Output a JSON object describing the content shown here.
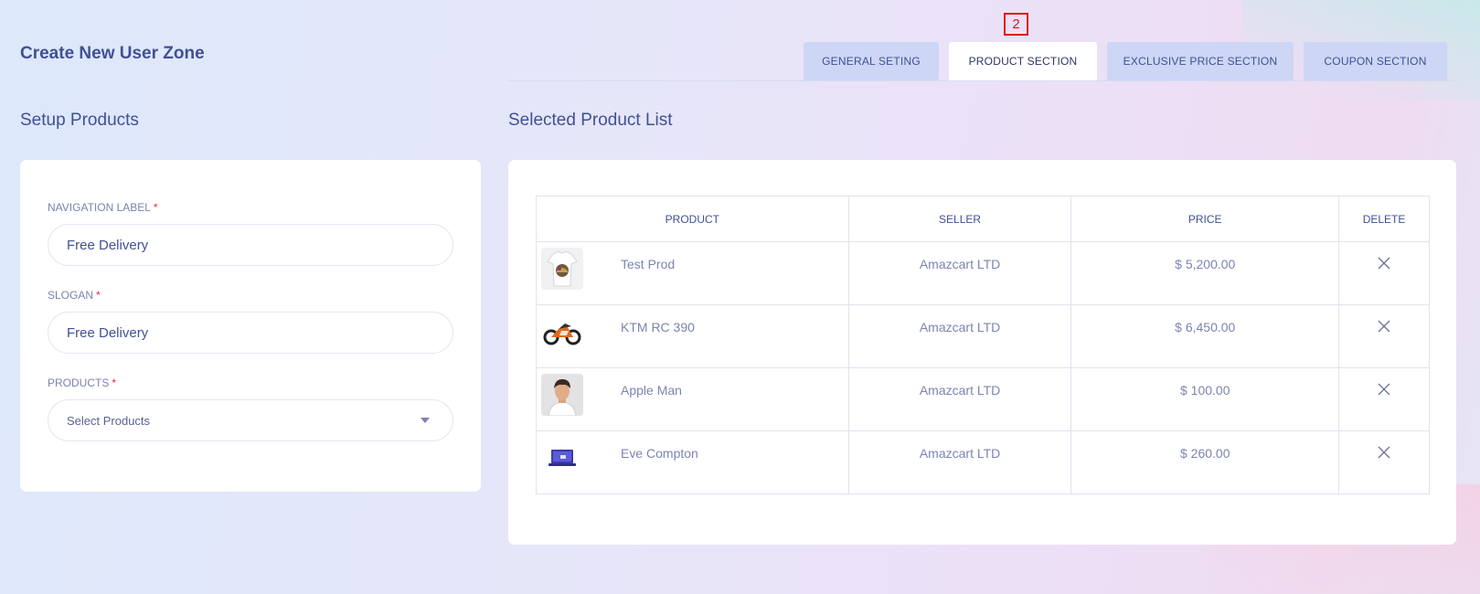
{
  "page": {
    "title": "Create New User Zone"
  },
  "tabs": {
    "marker": "2",
    "items": [
      {
        "label": "GENERAL SETING"
      },
      {
        "label": "PRODUCT SECTION",
        "active": true
      },
      {
        "label": "EXCLUSIVE PRICE SECTION"
      },
      {
        "label": "COUPON SECTION"
      }
    ]
  },
  "setup": {
    "title": "Setup Products",
    "navigation_label": {
      "label": "NAVIGATION LABEL",
      "required": "*",
      "value": "Free Delivery"
    },
    "slogan": {
      "label": "SLOGAN",
      "required": "*",
      "value": "Free Delivery"
    },
    "products": {
      "label": "PRODUCTS",
      "required": "*",
      "placeholder": "Select Products"
    }
  },
  "selected": {
    "title": "Selected Product List",
    "columns": {
      "product": "PRODUCT",
      "seller": "SELLER",
      "price": "PRICE",
      "delete": "DELETE"
    },
    "rows": [
      {
        "product": "Test Prod",
        "seller": "Amazcart LTD",
        "price": "$ 5,200.00",
        "thumb": "tshirt-image"
      },
      {
        "product": "KTM RC 390",
        "seller": "Amazcart LTD",
        "price": "$ 6,450.00",
        "thumb": "motorcycle-image"
      },
      {
        "product": "Apple Man",
        "seller": "Amazcart LTD",
        "price": "$ 100.00",
        "thumb": "man-image"
      },
      {
        "product": "Eve Compton",
        "seller": "Amazcart LTD",
        "price": "$ 260.00",
        "thumb": "laptop-image"
      }
    ],
    "delete_icon": "close-icon"
  },
  "colors": {
    "accent": "#415094",
    "tab_inactive": "#cdd6f4",
    "required": "#e9263b",
    "marker": "#e0101a"
  }
}
